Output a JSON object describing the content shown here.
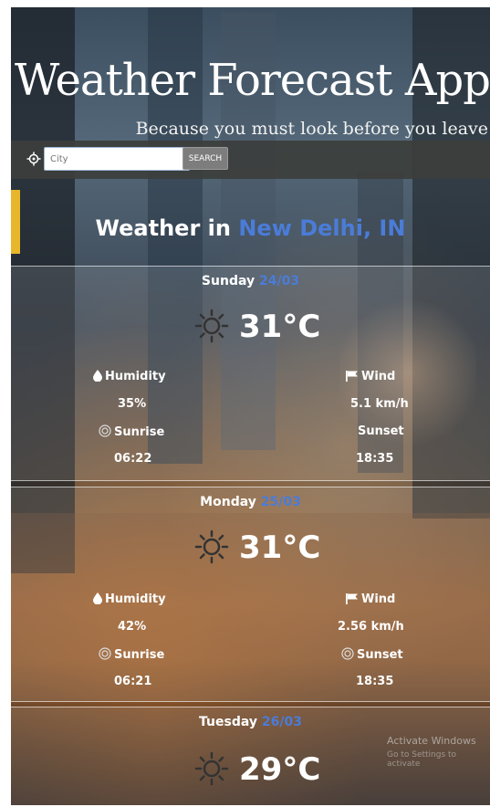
{
  "header": {
    "title": "Weather Forecast App",
    "subtitle": "Because you must look before you leave"
  },
  "search": {
    "placeholder": "City",
    "value": "",
    "button_label": "SEARCH",
    "location_icon": "crosshair-icon"
  },
  "location": {
    "prefix": "Weather in",
    "place": "New Delhi, IN",
    "accent_color": "#4a7cd8"
  },
  "forecast": [
    {
      "day": "Sunday",
      "date": "24/03",
      "icon": "sun-icon",
      "temp": "31°C",
      "humidity_label": "Humidity",
      "humidity": "35%",
      "wind_label": "Wind",
      "wind": "5.1 km/h",
      "sunrise_label": "Sunrise",
      "sunrise": "06:22",
      "sunset_label": "Sunset",
      "sunset": "18:35"
    },
    {
      "day": "Monday",
      "date": "25/03",
      "icon": "sun-icon",
      "temp": "31°C",
      "humidity_label": "Humidity",
      "humidity": "42%",
      "wind_label": "Wind",
      "wind": "2.56 km/h",
      "sunrise_label": "Sunrise",
      "sunrise": "06:21",
      "sunset_label": "Sunset",
      "sunset": "18:35"
    },
    {
      "day": "Tuesday",
      "date": "26/03",
      "icon": "sun-icon",
      "temp": "29°C"
    }
  ],
  "os_watermark": {
    "line1": "Activate Windows",
    "line2": "Go to Settings to activate"
  }
}
